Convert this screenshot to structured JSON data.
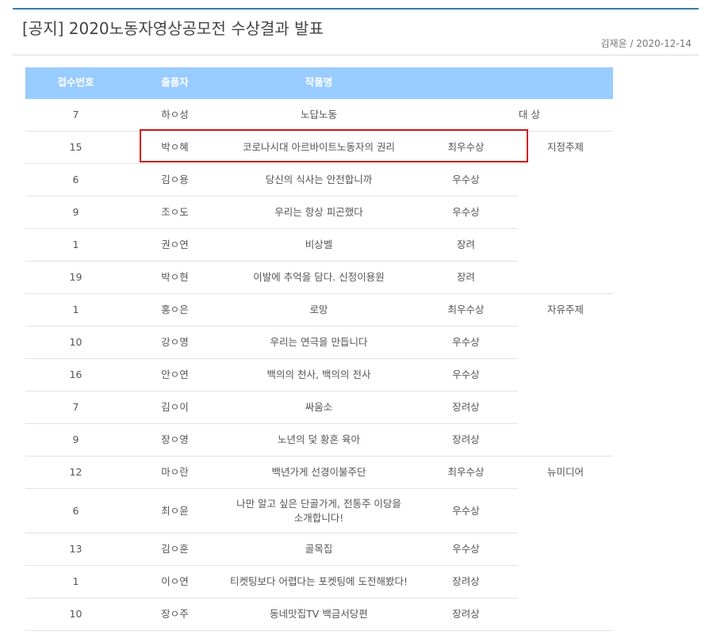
{
  "post": {
    "title": "[공지] 2020노동자영상공모전 수상결과 발표",
    "author_date": "김재윤 / 2020-12-14"
  },
  "table": {
    "headers": [
      "접수번호",
      "출품자",
      "작품명",
      "",
      ""
    ],
    "rows": [
      {
        "no": "7",
        "entrant": "하ㅇ성",
        "work": "노답노동",
        "award": "대 상",
        "category": ""
      },
      {
        "no": "15",
        "entrant": "박ㅇ혜",
        "work": "코로나시대 아르바이트노동자의 권리",
        "award": "최우수상",
        "category": "지정주제"
      },
      {
        "no": "6",
        "entrant": "김ㅇ용",
        "work": "당신의 식사는 안전합니까",
        "award": "우수상"
      },
      {
        "no": "9",
        "entrant": "조ㅇ도",
        "work": "우리는 항상 피곤했다",
        "award": "우수상"
      },
      {
        "no": "1",
        "entrant": "권ㅇ연",
        "work": "비상벨",
        "award": "장려"
      },
      {
        "no": "19",
        "entrant": "박ㅇ현",
        "work": "이발에 추억을 담다. 신정이용원",
        "award": "장려"
      },
      {
        "no": "1",
        "entrant": "홍ㅇ은",
        "work": "로망",
        "award": "최우수상",
        "category": "자유주제"
      },
      {
        "no": "10",
        "entrant": "강ㅇ명",
        "work": "우리는 연극을 만듭니다",
        "award": "우수상"
      },
      {
        "no": "16",
        "entrant": "안ㅇ연",
        "work": "백의의 천사, 백의의 전사",
        "award": "우수상"
      },
      {
        "no": "7",
        "entrant": "김ㅇ이",
        "work": "싸움소",
        "award": "장려상"
      },
      {
        "no": "9",
        "entrant": "장ㅇ영",
        "work": "노년의 덫 황혼 육아",
        "award": "장려상"
      },
      {
        "no": "12",
        "entrant": "마ㅇ란",
        "work": "백년가게 선경이불주단",
        "award": "최우수상",
        "category": "뉴미디어"
      },
      {
        "no": "6",
        "entrant": "최ㅇ윤",
        "work": "나만 알고 싶은 단골가게, 전통주 이당을 소개합니다!",
        "award": "우수상"
      },
      {
        "no": "13",
        "entrant": "김ㅇ훈",
        "work": "골목집",
        "award": "우수상"
      },
      {
        "no": "1",
        "entrant": "이ㅇ연",
        "work": "티켓팅보다 어렵다는 포켓팅에 도전해봤다!",
        "award": "장려상"
      },
      {
        "no": "10",
        "entrant": "장ㅇ주",
        "work": "동네맛집TV 백금서당편",
        "award": "장려상"
      }
    ]
  },
  "colors": {
    "header_bg": "#99ccff",
    "highlight_border": "#d01818",
    "top_rule": "#3a7ca5"
  }
}
